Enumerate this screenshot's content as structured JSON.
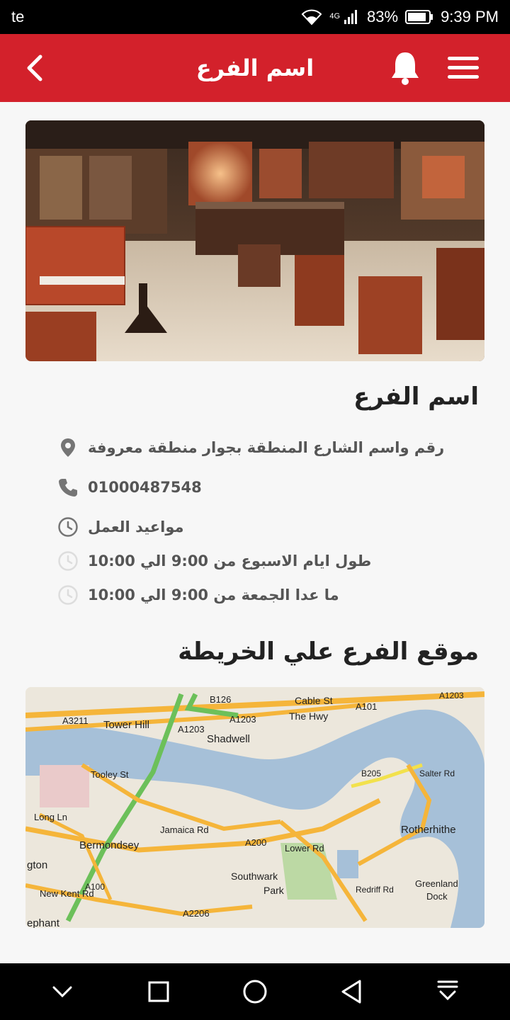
{
  "status_bar": {
    "carrier": "te",
    "network": "4G",
    "battery": "83%",
    "time": "9:39 PM"
  },
  "app_bar": {
    "title": "اسم الفرع"
  },
  "branch": {
    "name": "اسم الفرع",
    "address": "رقم واسم الشارع المنطقة بجوار منطقة معروفة",
    "phone": "01000487548",
    "hours_label": "مواعيد العمل",
    "hours_weekdays": "طول ايام الاسبوع من 9:00 الي 10:00",
    "hours_friday": "ما عدا الجمعة من 9:00 الي 10:00"
  },
  "map": {
    "title": "موقع الفرع علي الخريطة",
    "labels": {
      "tower_hill": "Tower Hill",
      "shadwell": "Shadwell",
      "cable_st": "Cable St",
      "the_hwy": "The Hwy",
      "b126": "B126",
      "a3211": "A3211",
      "a1203a": "A1203",
      "a1203b": "A1203",
      "a101": "A101",
      "a1203c": "A1203",
      "tooley_st": "Tooley St",
      "b205": "B205",
      "salter_rd": "Salter Rd",
      "rotherhithe": "Rotherhithe",
      "long_ln": "Long Ln",
      "bermondsey": "Bermondsey",
      "jamaica_rd": "Jamaica Rd",
      "a200": "A200",
      "lower_rd": "Lower Rd",
      "southwark": "Southwark",
      "park": "Park",
      "redriff_rd": "Redriff Rd",
      "greenland": "Greenland",
      "dock": "Dock",
      "gton": "gton",
      "a100": "A100",
      "new_kent_rd": "New Kent Rd",
      "a2206": "A2206",
      "ephant": "ephant"
    }
  },
  "colors": {
    "primary": "#d3212b",
    "text_dark": "#222222",
    "text_muted": "#555555",
    "icon_grey": "#757575",
    "icon_light": "#dddddd"
  }
}
